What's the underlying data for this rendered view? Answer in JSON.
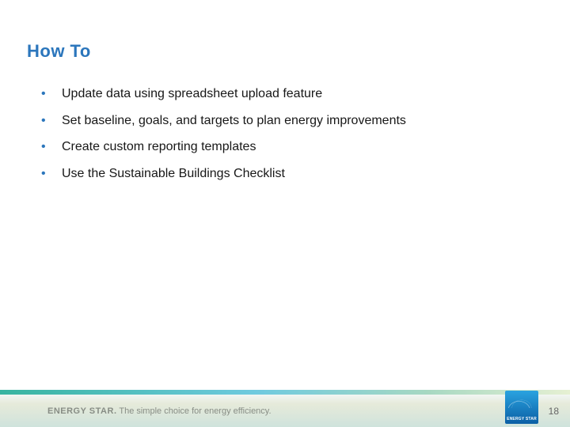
{
  "title": "How To",
  "bullets": [
    "Update data using spreadsheet upload feature",
    "Set baseline, goals, and targets to plan energy improvements",
    "Create custom reporting templates",
    "Use the Sustainable Buildings Checklist"
  ],
  "footer": {
    "brand": "ENERGY STAR.",
    "tagline": " The simple choice for energy efficiency."
  },
  "logo_text": "ENERGY STAR",
  "page_number": "18"
}
